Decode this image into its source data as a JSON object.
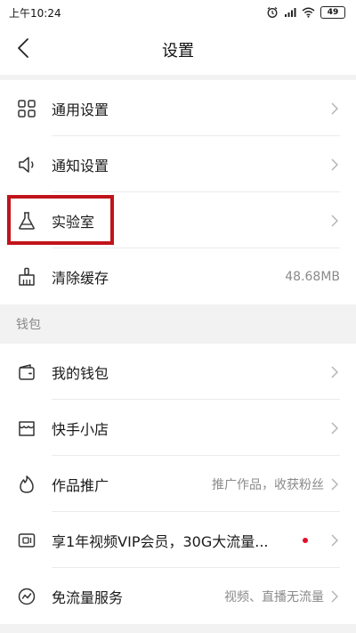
{
  "status_bar": {
    "time": "上午10:24",
    "battery": "49",
    "icons": [
      "alarm-icon",
      "signal-icon",
      "wifi-icon",
      "battery-icon"
    ]
  },
  "header": {
    "title": "设置",
    "back_icon": "chevron-left-icon"
  },
  "settings_group": [
    {
      "label": "通用设置",
      "icon": "grid-icon",
      "value": ""
    },
    {
      "label": "通知设置",
      "icon": "speaker-icon",
      "value": ""
    },
    {
      "label": "实验室",
      "icon": "flask-icon",
      "value": ""
    },
    {
      "label": "清除缓存",
      "icon": "broom-icon",
      "value": "48.68MB"
    }
  ],
  "wallet_section": {
    "header": "钱包",
    "items": [
      {
        "label": "我的钱包",
        "icon": "wallet-icon",
        "value": ""
      },
      {
        "label": "快手小店",
        "icon": "shop-icon",
        "value": ""
      },
      {
        "label": "作品推广",
        "icon": "flame-icon",
        "value": "推广作品，收获粉丝"
      },
      {
        "label": "享1年视频VIP会员，30G大流量...",
        "icon": "card-icon",
        "value": ""
      },
      {
        "label": "免流量服务",
        "icon": "free-data-icon",
        "value": "视频、直播无流量"
      }
    ]
  },
  "colors": {
    "highlight_border": "#c0141a",
    "red_dot": "#e0102a",
    "background": "#f2f2f2"
  }
}
